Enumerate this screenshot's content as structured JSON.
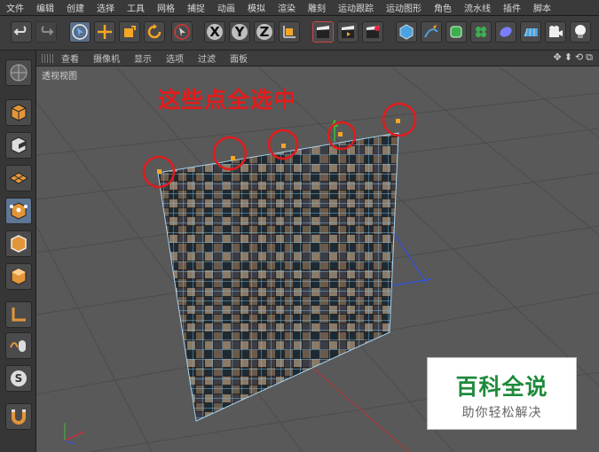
{
  "menubar": {
    "items": [
      "文件",
      "编辑",
      "创建",
      "选择",
      "工具",
      "网格",
      "捕捉",
      "动画",
      "模拟",
      "渲染",
      "雕刻",
      "运动跟踪",
      "运动图形",
      "角色",
      "流水线",
      "插件",
      "脚本"
    ]
  },
  "viewport_menu": {
    "items": [
      "查看",
      "摄像机",
      "显示",
      "选项",
      "过滤",
      "面板"
    ],
    "nav_icons": "✥⬍⟲⧉"
  },
  "viewport": {
    "label": "透视视图",
    "annotation": "这些点全选中"
  },
  "toolbar": {
    "axis_x": "X",
    "axis_y": "Y",
    "axis_z": "Z"
  },
  "watermark": {
    "title": "百科全说",
    "subtitle": "助你轻松解决"
  },
  "colors": {
    "annotation_red": "#e21b1b",
    "watermark_green": "#1e8a3a",
    "viewport_bg": "#595959",
    "selected_point": "#f5a623"
  }
}
